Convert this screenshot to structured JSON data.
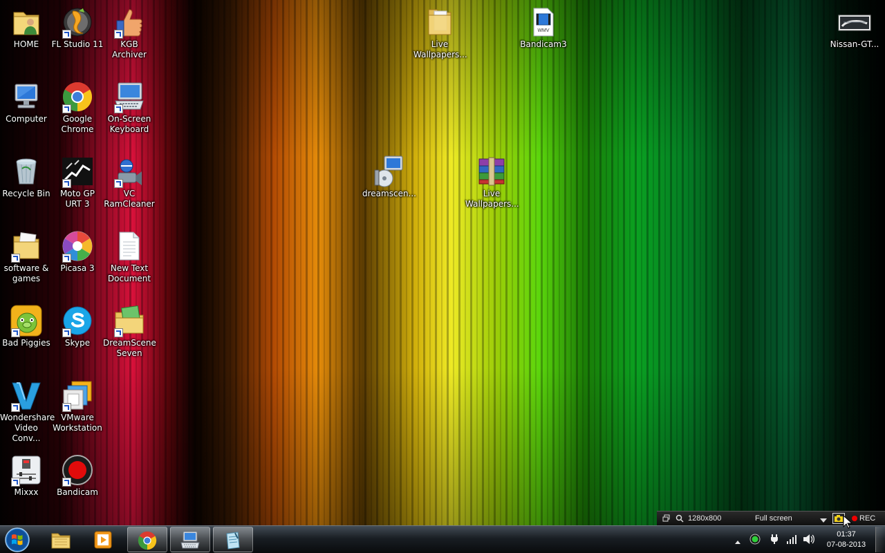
{
  "desktop": {
    "icons": [
      {
        "label": "HOME",
        "icon": "folder-user-icon",
        "shortcut": false
      },
      {
        "label": "FL Studio 11",
        "icon": "fl-studio-icon",
        "shortcut": true
      },
      {
        "label": "KGB Archiver",
        "icon": "kgb-archiver-icon",
        "shortcut": true
      },
      {
        "label": "Computer",
        "icon": "computer-icon",
        "shortcut": false
      },
      {
        "label": "Google\nChrome",
        "icon": "chrome-icon",
        "shortcut": true
      },
      {
        "label": "On-Screen\nKeyboard",
        "icon": "keyboard-icon",
        "shortcut": true
      },
      {
        "label": "Recycle Bin",
        "icon": "recycle-bin-icon",
        "shortcut": false
      },
      {
        "label": "Moto GP\nURT 3",
        "icon": "motogp-icon",
        "shortcut": true
      },
      {
        "label": "VC\nRamCleaner",
        "icon": "ram-cleaner-icon",
        "shortcut": true
      },
      {
        "label": "software &\ngames",
        "icon": "folder-icon",
        "shortcut": true
      },
      {
        "label": "Picasa 3",
        "icon": "picasa-icon",
        "shortcut": true
      },
      {
        "label": "New Text\nDocument",
        "icon": "text-document-icon",
        "shortcut": false
      },
      {
        "label": "Bad Piggies",
        "icon": "bad-piggies-icon",
        "shortcut": true
      },
      {
        "label": "Skype",
        "icon": "skype-icon",
        "shortcut": true
      },
      {
        "label": "DreamScene\nSeven",
        "icon": "dreamscene-icon",
        "shortcut": true
      },
      {
        "label": "Wondershare\nVideo Conv...",
        "icon": "wondershare-icon",
        "shortcut": true
      },
      {
        "label": "VMware\nWorkstation",
        "icon": "vmware-icon",
        "shortcut": true
      },
      {
        "label": "Mixxx",
        "icon": "mixxx-icon",
        "shortcut": true
      },
      {
        "label": "Bandicam",
        "icon": "bandicam-icon",
        "shortcut": true
      },
      {
        "label": "dreamscen...",
        "icon": "installer-icon",
        "shortcut": false
      },
      {
        "label": "Live\nWallpapers...",
        "icon": "folder-icon",
        "shortcut": false
      },
      {
        "label": "Live\nWallpapers...",
        "icon": "winrar-icon",
        "shortcut": false
      },
      {
        "label": "Bandicam3",
        "icon": "wmv-file-icon",
        "shortcut": false
      },
      {
        "label": "Nissan-GT...",
        "icon": "image-thumbnail-icon",
        "shortcut": false
      }
    ]
  },
  "recorder_bar": {
    "resolution": "1280x800",
    "mode": "Full screen",
    "rec_label": "REC"
  },
  "taskbar": {
    "pinned": [
      {
        "icon": "explorer-folder-icon",
        "active": false
      },
      {
        "icon": "media-player-icon",
        "active": false
      },
      {
        "icon": "chrome-icon",
        "active": true
      },
      {
        "icon": "on-screen-keyboard-icon",
        "active": true
      },
      {
        "icon": "notepad-icon",
        "active": true
      }
    ],
    "clock": {
      "time": "01:37",
      "date": "07-08-2013"
    }
  }
}
